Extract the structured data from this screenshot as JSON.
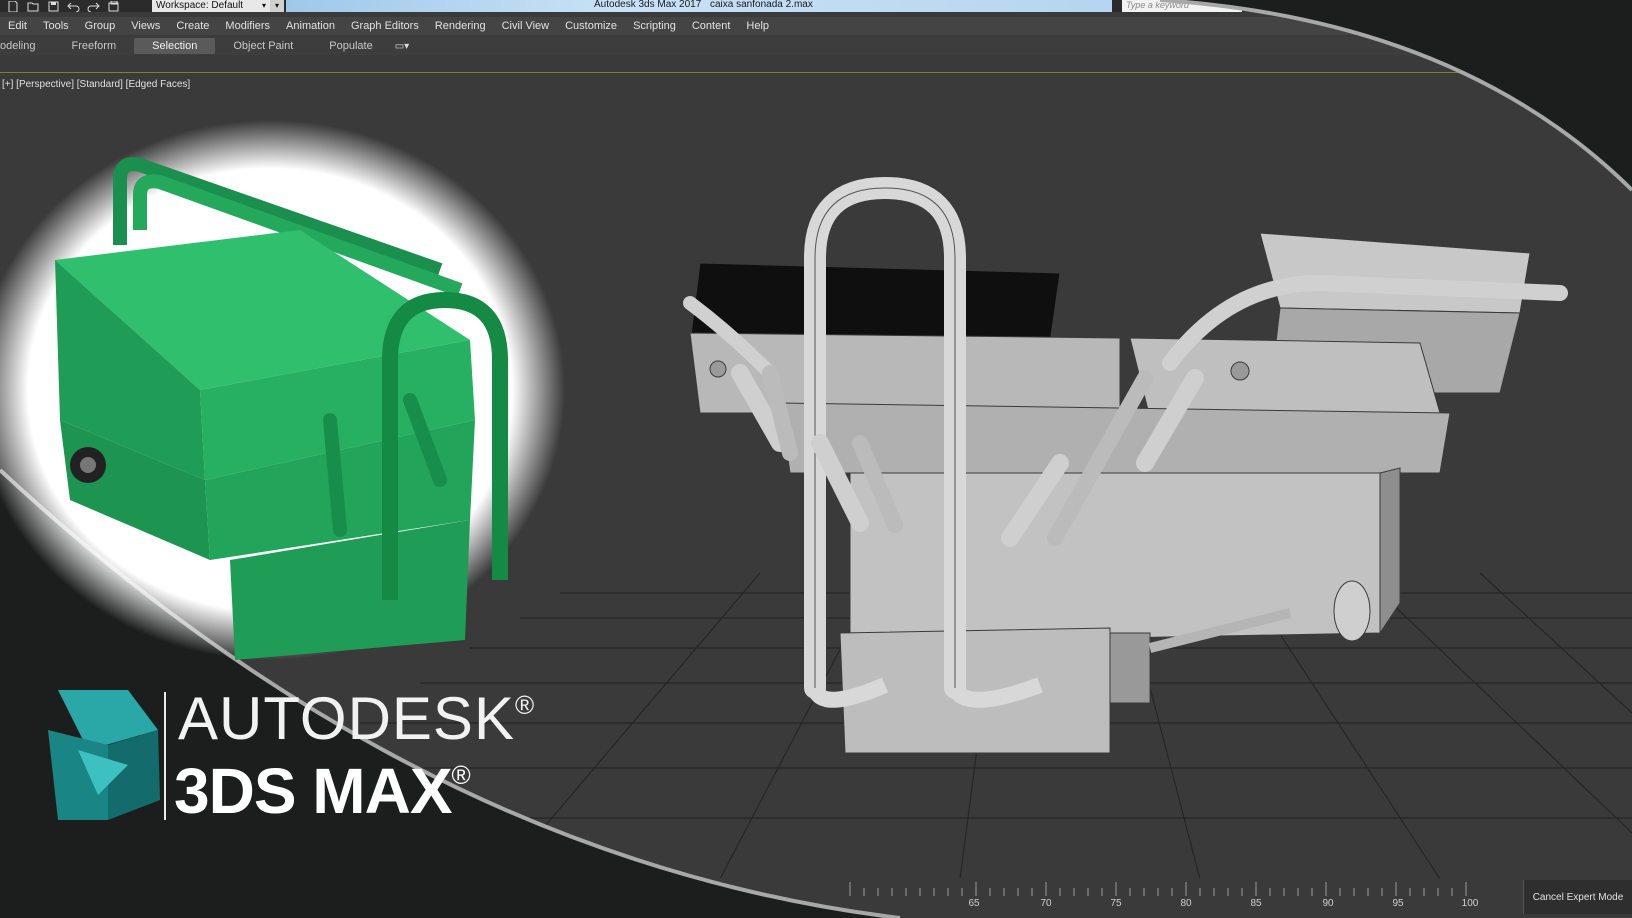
{
  "titlebar": {
    "workspace_label": "Workspace: Default",
    "app_title": "Autodesk 3ds Max 2017",
    "file_name": "caixa sanfonada 2.max",
    "search_placeholder": "Type a keyword"
  },
  "menu": [
    "Edit",
    "Tools",
    "Group",
    "Views",
    "Create",
    "Modifiers",
    "Animation",
    "Graph Editors",
    "Rendering",
    "Civil View",
    "Customize",
    "Scripting",
    "Content",
    "Help"
  ],
  "ribbon_tabs": [
    {
      "label": "odeling",
      "active": false
    },
    {
      "label": "Freeform",
      "active": false
    },
    {
      "label": "Selection",
      "active": true
    },
    {
      "label": "Object Paint",
      "active": false
    },
    {
      "label": "Populate",
      "active": false
    }
  ],
  "viewport": {
    "label": "[+] [Perspective] [Standard] [Edged Faces]"
  },
  "timeline": {
    "ticks": [
      "65",
      "70",
      "75",
      "80",
      "85",
      "90",
      "95",
      "100"
    ],
    "cancel_label": "Cancel Expert Mode"
  },
  "brand": {
    "line1": "AUTODESK",
    "line2": "3DS MAX",
    "reg_mark": "®",
    "logo_color": "#1e9b9b"
  },
  "colors": {
    "toolbox_green": "#1fa15a",
    "viewport_bg": "#3a3a3a",
    "overlay_bg": "#1c1e1e"
  }
}
